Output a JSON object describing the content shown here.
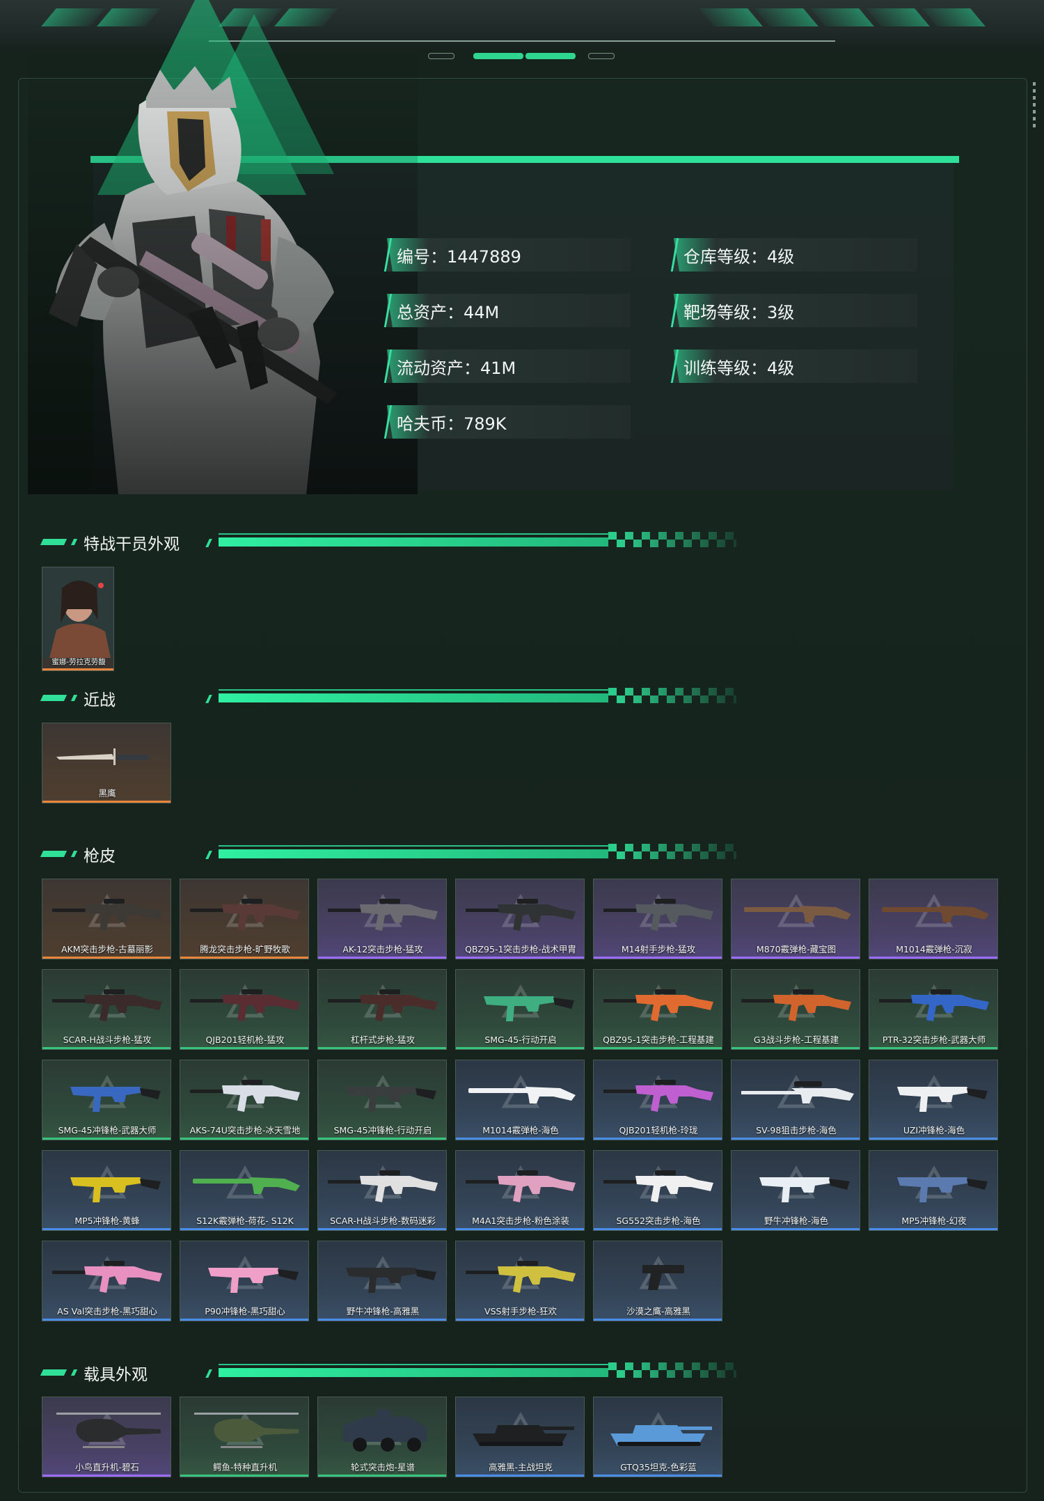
{
  "info": {
    "id": "编号：1447889",
    "warehouse": "仓库等级：4级",
    "total_assets": "总资产：44M",
    "range": "靶场等级：3级",
    "liquid_assets": "流动资产：41M",
    "training": "训练等级：4级",
    "havoc_coins": "哈夫币：789K"
  },
  "sections": {
    "operators": "特战干员外观",
    "melee": "近战",
    "guns": "枪皮",
    "vehicles": "载具外观"
  },
  "operators": [
    {
      "label": "蜜娜-劳拉克劳馥",
      "color": "#e7853a"
    }
  ],
  "melee": [
    {
      "label": "黑鹰",
      "quality": "orange"
    }
  ],
  "guns": [
    {
      "label": "AKM突击步枪-古墓丽影",
      "quality": "orange",
      "icon": "rifle-icon"
    },
    {
      "label": "腾龙突击步枪-旷野牧歌",
      "quality": "orange",
      "icon": "rifle-icon"
    },
    {
      "label": "AK-12突击步枪-猛攻",
      "quality": "purple",
      "icon": "rifle-icon"
    },
    {
      "label": "QBZ95-1突击步枪-战术甲胄",
      "quality": "purple",
      "icon": "rifle-icon"
    },
    {
      "label": "M14射手步枪-猛攻",
      "quality": "purple",
      "icon": "rifle-icon"
    },
    {
      "label": "M870霰弹枪-藏宝图",
      "quality": "purple",
      "icon": "shotgun-icon"
    },
    {
      "label": "M1014霰弹枪-沉寂",
      "quality": "purple",
      "icon": "shotgun-icon"
    },
    {
      "label": "SCAR-H战斗步枪-猛攻",
      "quality": "green",
      "icon": "rifle-icon"
    },
    {
      "label": "QJB201轻机枪-猛攻",
      "quality": "green",
      "icon": "rifle-icon"
    },
    {
      "label": "杠杆式步枪-猛攻",
      "quality": "green",
      "icon": "rifle-icon"
    },
    {
      "label": "SMG-45-行动开启",
      "quality": "green",
      "icon": "smg-icon"
    },
    {
      "label": "QBZ95-1突击步枪-工程基建",
      "quality": "green",
      "icon": "rifle-icon"
    },
    {
      "label": "G3战斗步枪-工程基建",
      "quality": "green",
      "icon": "rifle-icon"
    },
    {
      "label": "PTR-32突击步枪-武器大师",
      "quality": "green",
      "icon": "rifle-icon"
    },
    {
      "label": "SMG-45冲锋枪-武器大师",
      "quality": "green",
      "icon": "smg-icon"
    },
    {
      "label": "AKS-74U突击步枪-冰天雪地",
      "quality": "green",
      "icon": "rifle-icon"
    },
    {
      "label": "SMG-45冲锋枪-行动开启",
      "quality": "green",
      "icon": "smg-icon"
    },
    {
      "label": "M1014霰弹枪-海色",
      "quality": "blue",
      "icon": "shotgun-icon"
    },
    {
      "label": "QJB201轻机枪-玲珑",
      "quality": "blue",
      "icon": "rifle-icon"
    },
    {
      "label": "SV-98狙击步枪-海色",
      "quality": "blue",
      "icon": "sniper-icon"
    },
    {
      "label": "UZI冲锋枪-海色",
      "quality": "blue",
      "icon": "smg-icon"
    },
    {
      "label": "MP5冲锋枪-黄蜂",
      "quality": "blue",
      "icon": "smg-icon"
    },
    {
      "label": "S12K霰弹枪-荷花- S12K",
      "quality": "blue",
      "icon": "shotgun-icon"
    },
    {
      "label": "SCAR-H战斗步枪-数码迷彩",
      "quality": "blue",
      "icon": "rifle-icon"
    },
    {
      "label": "M4A1突击步枪-粉色涂装",
      "quality": "blue",
      "icon": "rifle-icon"
    },
    {
      "label": "SG552突击步枪-海色",
      "quality": "blue",
      "icon": "rifle-icon"
    },
    {
      "label": "野牛冲锋枪-海色",
      "quality": "blue",
      "icon": "smg-icon"
    },
    {
      "label": "MP5冲锋枪-幻夜",
      "quality": "blue",
      "icon": "smg-icon"
    },
    {
      "label": "AS Val突击步枪-黑巧甜心",
      "quality": "blue",
      "icon": "rifle-icon"
    },
    {
      "label": "P90冲锋枪-黑巧甜心",
      "quality": "blue",
      "icon": "smg-icon"
    },
    {
      "label": "野牛冲锋枪-高雅黑",
      "quality": "blue",
      "icon": "smg-icon"
    },
    {
      "label": "VSS射手步枪-狂欢",
      "quality": "blue",
      "icon": "rifle-icon"
    },
    {
      "label": "沙漠之鹰-高雅黑",
      "quality": "blue",
      "icon": "pistol-icon"
    }
  ],
  "vehicles": [
    {
      "label": "小鸟直升机-碧石",
      "quality": "purple",
      "icon": "helicopter-icon"
    },
    {
      "label": "鳄鱼-特种直升机",
      "quality": "green",
      "icon": "helicopter-icon"
    },
    {
      "label": "轮式突击炮-星谱",
      "quality": "green",
      "icon": "armored-car-icon"
    },
    {
      "label": "高雅黑-主战坦克",
      "quality": "blue",
      "icon": "tank-icon"
    },
    {
      "label": "GTQ35坦克-色彩蓝",
      "quality": "blue",
      "icon": "tank-icon"
    }
  ],
  "colors": {
    "accent": "#2fe09a",
    "orange": "#e7853a",
    "purple": "#9b6cff",
    "green": "#37c47c",
    "blue": "#4a8de8"
  }
}
